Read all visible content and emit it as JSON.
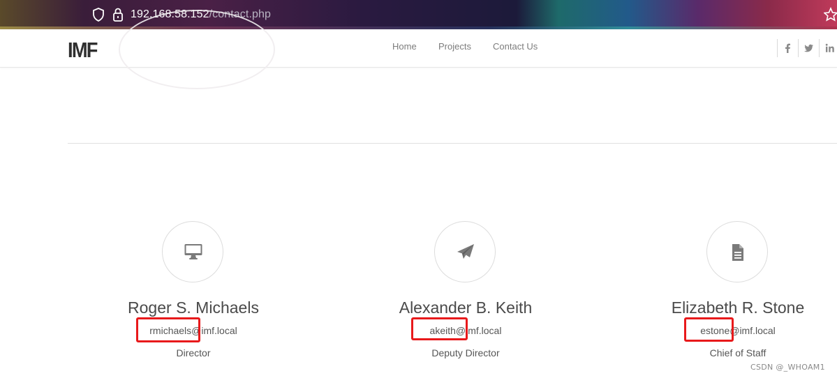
{
  "browser": {
    "url_host": "192.168.58.152",
    "url_path": "/contact.php"
  },
  "header": {
    "logo": "IMF",
    "nav": [
      {
        "label": "Home"
      },
      {
        "label": "Projects"
      },
      {
        "label": "Contact Us"
      }
    ],
    "social": [
      "facebook-icon",
      "twitter-icon",
      "linkedin-icon"
    ]
  },
  "contacts": [
    {
      "icon": "desktop-icon",
      "name": "Roger S. Michaels",
      "email": "rmichaels@imf.local",
      "role": "Director"
    },
    {
      "icon": "paper-plane-icon",
      "name": "Alexander B. Keith",
      "email": "akeith@imf.local",
      "role": "Deputy Director"
    },
    {
      "icon": "document-icon",
      "name": "Elizabeth R. Stone",
      "email": "estone@imf.local",
      "role": "Chief of Staff"
    }
  ],
  "annotation": {
    "highlight_color": "#e8191b"
  },
  "watermark": "CSDN @_WHOAM1"
}
